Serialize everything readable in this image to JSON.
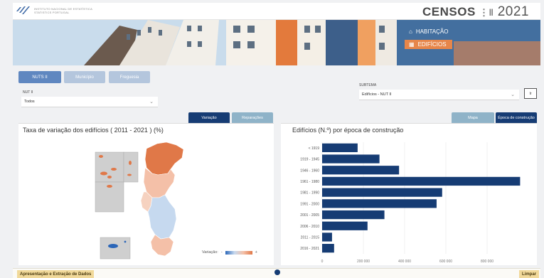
{
  "header": {
    "institute_line1": "Instituto Nacional de Estatística",
    "institute_line2": "Statistics Portugal",
    "censos_word": "CENSOS",
    "censos_year": "2021"
  },
  "banner_nav": {
    "items": [
      {
        "label": "HABITAÇÃO",
        "icon": "house-icon",
        "active": false
      },
      {
        "label": "EDIFÍCIOS",
        "icon": "building-icon",
        "active": true
      }
    ]
  },
  "geo_tabs": [
    {
      "label": "NUTS II",
      "active": true
    },
    {
      "label": "Município",
      "active": false
    },
    {
      "label": "Freguesia",
      "active": false
    }
  ],
  "filters": {
    "nut_label": "NUT II",
    "nut_value": "Todos",
    "subtema_label": "SUBTEMA",
    "subtema_value": "Edifícios - NUT II",
    "side_button": "Ir"
  },
  "map_panel": {
    "title": "Taxa de variação dos edifícios ( 2011 - 2021 ) (%)",
    "tabs": [
      "Variação",
      "Reparações"
    ],
    "legend_label": "Variação:",
    "legend_min": "-",
    "legend_max": "+",
    "colors": {
      "high": "#e07848",
      "mid": "#f4c0a8",
      "low": "#c6d9ef",
      "grey": "#cfcfcf",
      "azores": "#2b66b8"
    }
  },
  "chart_panel": {
    "title": "Edifícios (N.º) por época de construção",
    "tabs": [
      "Mapa",
      "Época de construção"
    ]
  },
  "chart_data": {
    "type": "bar",
    "orientation": "horizontal",
    "categories": [
      "< 1919",
      "1919 - 1945",
      "1946 - 1960",
      "1961 - 1980",
      "1981 - 1990",
      "1991 - 2000",
      "2001 - 2005",
      "2006 - 2010",
      "2011 - 2015",
      "2016 - 2021"
    ],
    "values": [
      172000,
      278000,
      373000,
      960000,
      582000,
      555000,
      302000,
      220000,
      48000,
      58000
    ],
    "xticks": [
      0,
      200000,
      400000,
      600000,
      800000
    ],
    "xtick_labels": [
      "0",
      "200 000",
      "400 000",
      "600 000",
      "800 000"
    ],
    "xlim": [
      0,
      1000000
    ],
    "bar_color": "#163c74",
    "grid": true
  },
  "footer": {
    "left_label": "Apresentação e Extração de Dados",
    "right_label": "Limpar"
  }
}
